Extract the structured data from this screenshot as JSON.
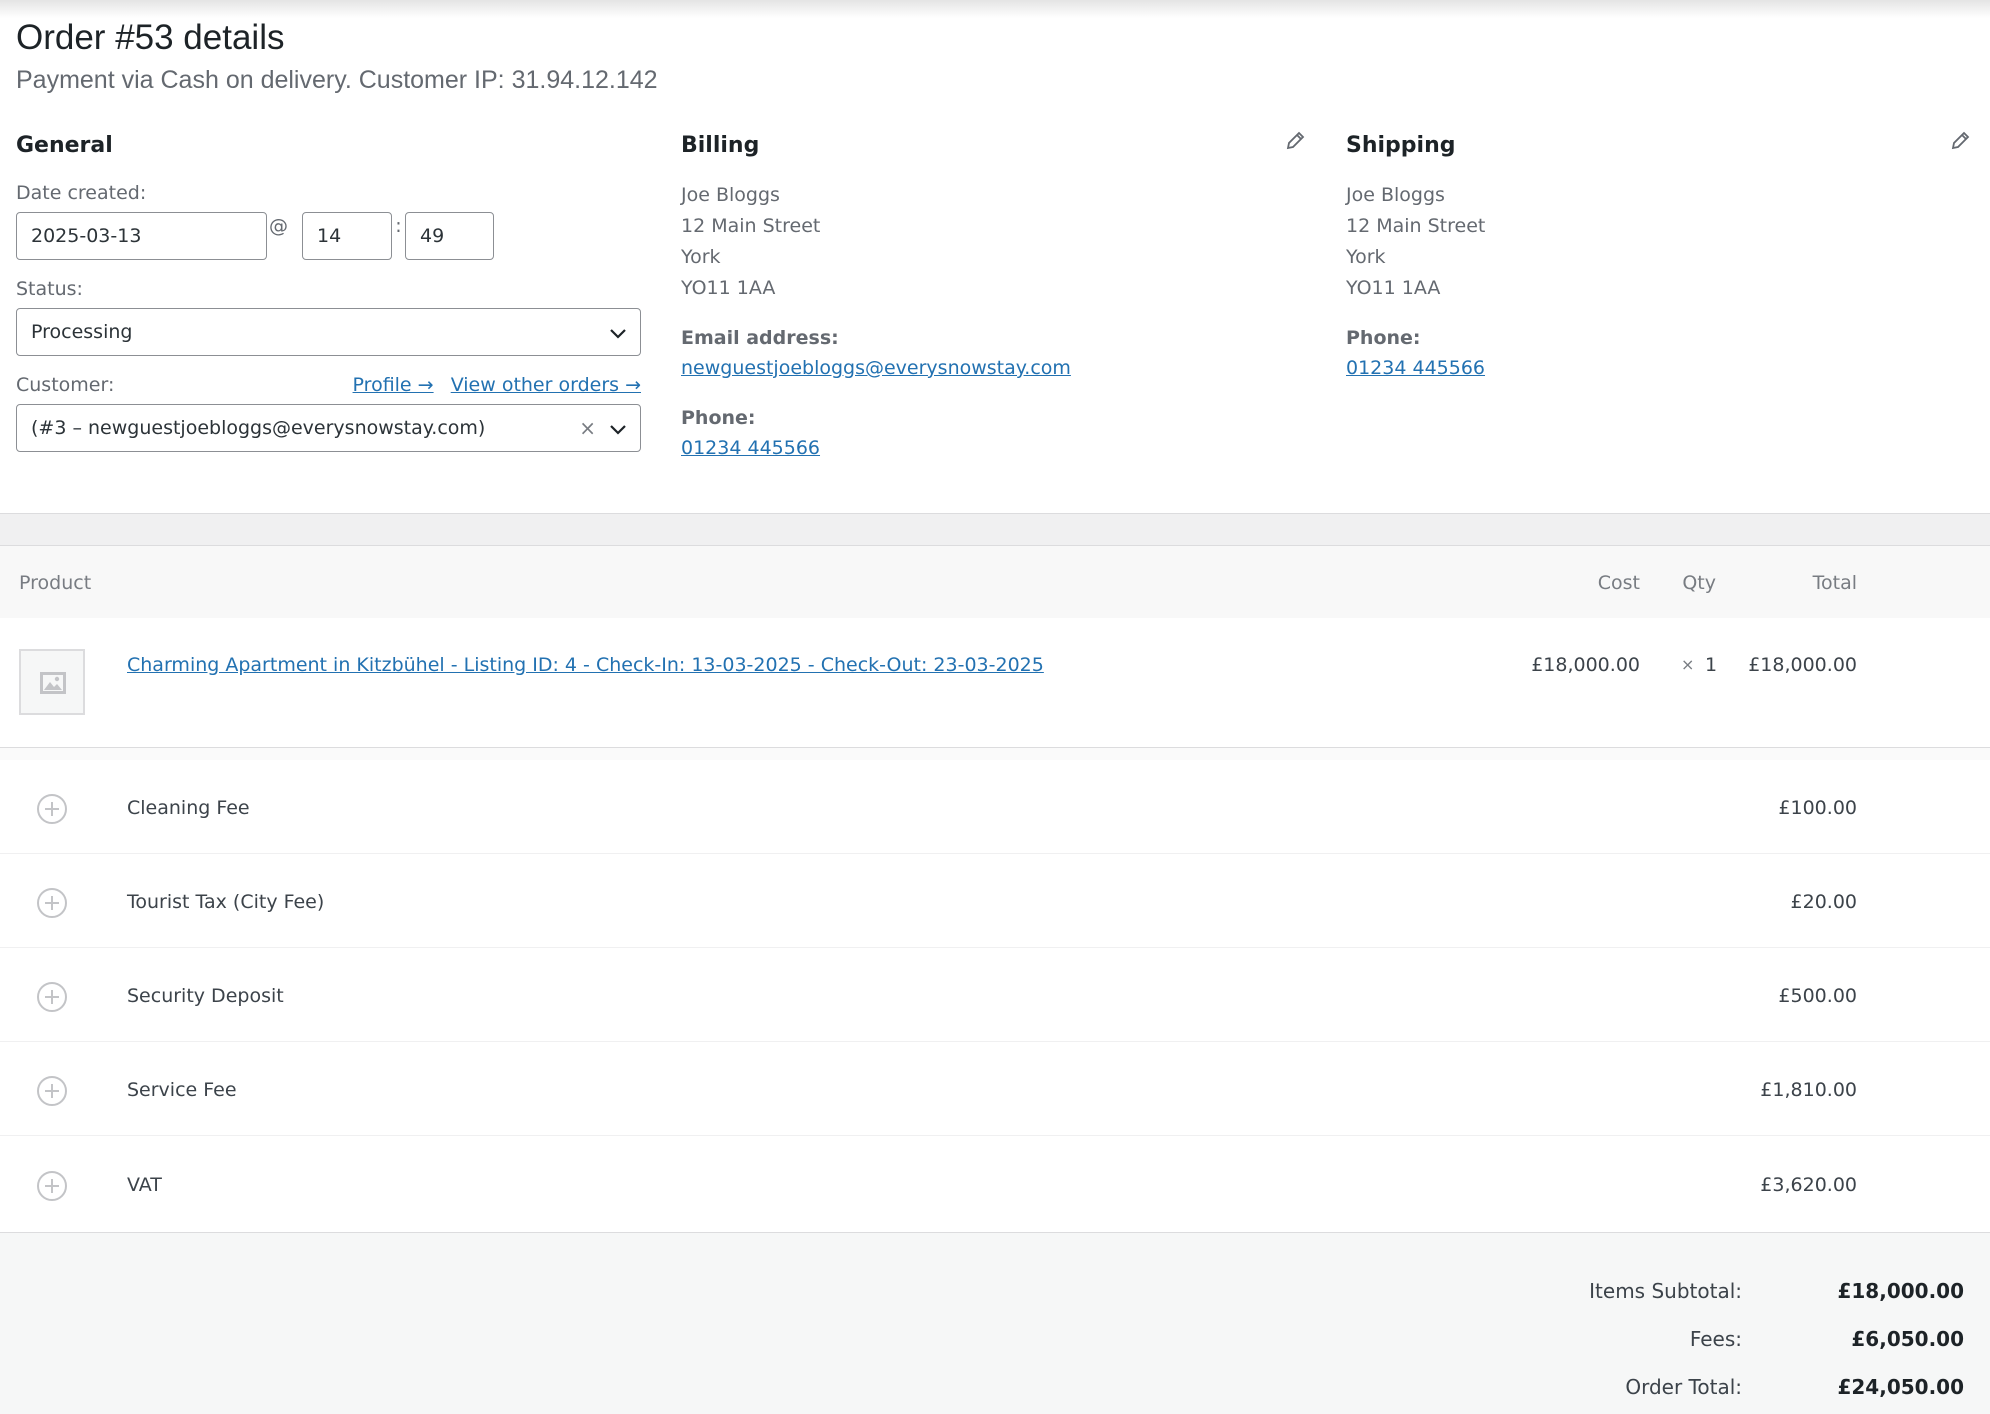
{
  "header": {
    "title": "Order #53 details",
    "subtitle": "Payment via Cash on delivery. Customer IP: 31.94.12.142"
  },
  "general": {
    "heading": "General",
    "date_label": "Date created:",
    "date_value": "2025-03-13",
    "at_sign": "@",
    "hour_value": "14",
    "colon": ":",
    "minute_value": "49",
    "status_label": "Status:",
    "status_value": "Processing",
    "customer_label": "Customer:",
    "profile_link": "Profile →",
    "other_orders_link": "View other orders →",
    "customer_value": "(#3 – newguestjoebloggs@everysnowstay.com)",
    "clear_symbol": "×"
  },
  "billing": {
    "heading": "Billing",
    "address_lines": [
      "Joe Bloggs",
      "12 Main Street",
      "York",
      "YO11 1AA"
    ],
    "email_label": "Email address:",
    "email_value": "newguestjoebloggs@everysnowstay.com",
    "phone_label": "Phone:",
    "phone_value": "01234 445566"
  },
  "shipping": {
    "heading": "Shipping",
    "address_lines": [
      "Joe Bloggs",
      "12 Main Street",
      "York",
      "YO11 1AA"
    ],
    "phone_label": "Phone:",
    "phone_value": "01234 445566"
  },
  "items": {
    "columns": {
      "product": "Product",
      "cost": "Cost",
      "qty": "Qty",
      "total": "Total"
    },
    "product": {
      "name": "Charming Apartment in Kitzbühel - Listing ID: 4 - Check-In: 13-03-2025 - Check-Out: 23-03-2025",
      "cost": "£18,000.00",
      "qty_symbol": "×",
      "qty": "1",
      "total": "£18,000.00"
    },
    "fees": [
      {
        "name": "Cleaning Fee",
        "total": "£100.00"
      },
      {
        "name": "Tourist Tax (City Fee)",
        "total": "£20.00"
      },
      {
        "name": "Security Deposit",
        "total": "£500.00"
      },
      {
        "name": "Service Fee",
        "total": "£1,810.00"
      },
      {
        "name": "VAT",
        "total": "£3,620.00"
      }
    ]
  },
  "totals": {
    "items_subtotal_label": "Items Subtotal:",
    "items_subtotal_value": "£18,000.00",
    "fees_label": "Fees:",
    "fees_value": "£6,050.00",
    "order_total_label": "Order Total:",
    "order_total_value": "£24,050.00"
  },
  "colors": {
    "link": "#2271b1",
    "text": "#3c434a",
    "muted": "#646970"
  },
  "icons": {
    "edit": "pencil-icon",
    "select_arrow": "chevron-down-icon",
    "fee": "plus-circle-icon",
    "thumbnail": "image-placeholder-icon"
  }
}
